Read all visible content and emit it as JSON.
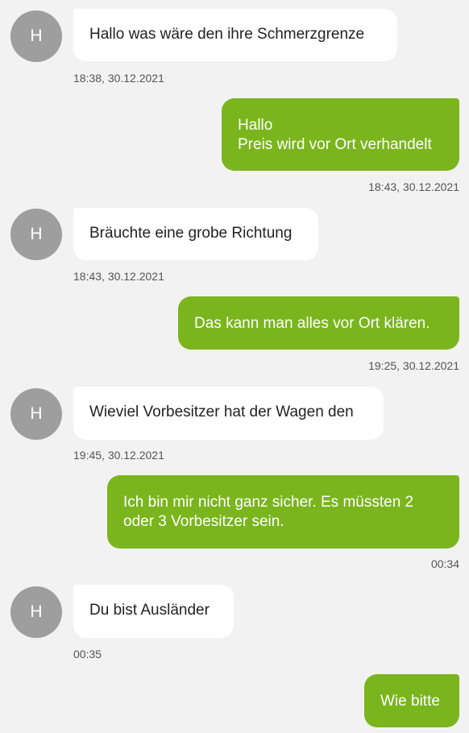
{
  "messages": [
    {
      "sender": "contact",
      "avatar": "H",
      "text": "Hallo was wäre den ihre Schmerzgrenze",
      "time": "18:38, 30.12.2021"
    },
    {
      "sender": "me",
      "text": "Hallo\nPreis wird vor Ort verhandelt",
      "time": "18:43, 30.12.2021"
    },
    {
      "sender": "contact",
      "avatar": "H",
      "text": "Bräuchte eine grobe Richtung",
      "time": "18:43, 30.12.2021"
    },
    {
      "sender": "me",
      "text": "Das kann man alles vor Ort klären.",
      "time": "19:25, 30.12.2021"
    },
    {
      "sender": "contact",
      "avatar": "H",
      "text": "Wieviel Vorbesitzer hat der Wagen den",
      "time": "19:45, 30.12.2021"
    },
    {
      "sender": "me",
      "text": "Ich bin mir nicht ganz sicher. Es müssten 2 oder 3 Vorbesitzer sein.",
      "time": "00:34"
    },
    {
      "sender": "contact",
      "avatar": "H",
      "text": "Du bist Ausländer",
      "time": "00:35"
    },
    {
      "sender": "me",
      "text": "Wie bitte",
      "time": ""
    }
  ],
  "colors": {
    "outgoing_bubble": "#7ab51d",
    "incoming_bubble": "#ffffff",
    "avatar": "#9e9e9e",
    "background": "#f2f2f2"
  }
}
